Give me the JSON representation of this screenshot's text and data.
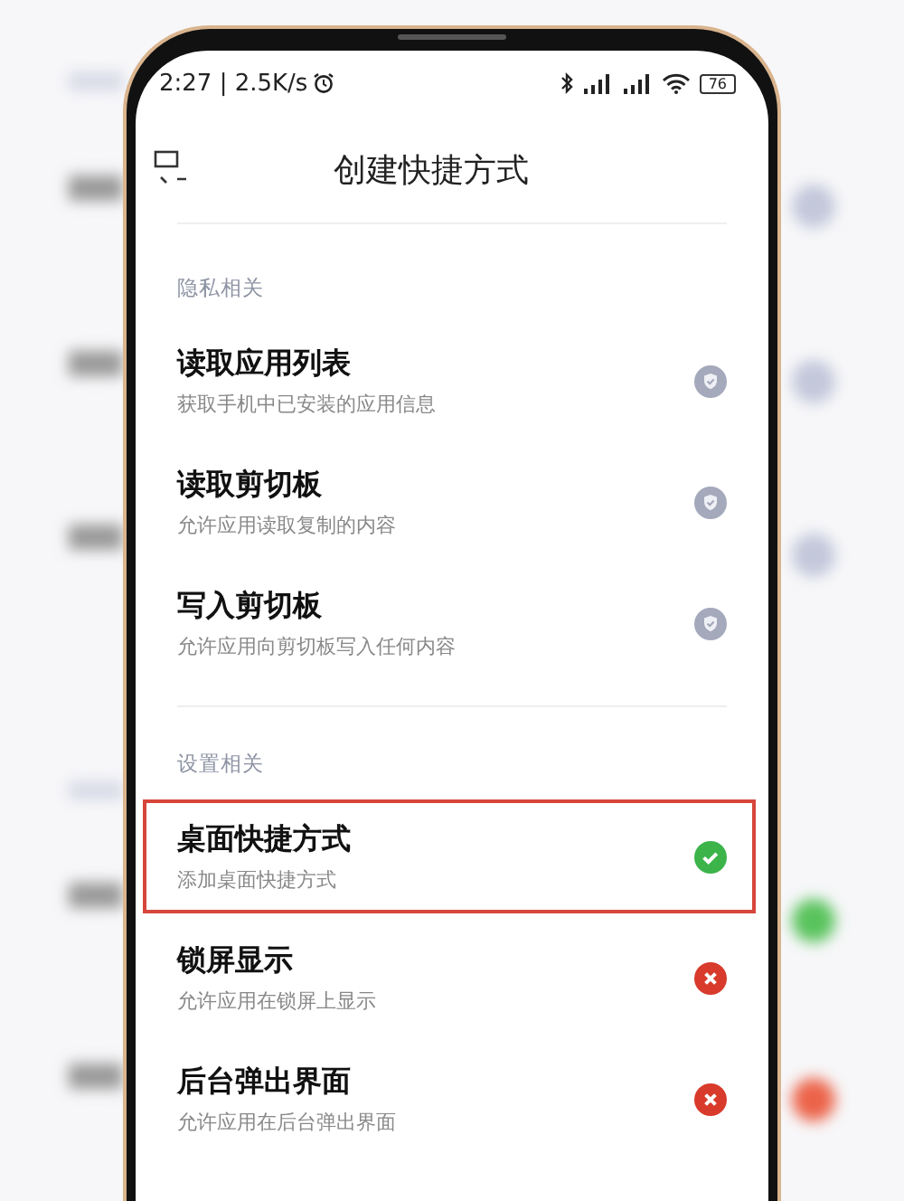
{
  "status_bar": {
    "time_speed": "2:27 | 2.5K/s",
    "battery": "76"
  },
  "header": {
    "title": "创建快捷方式"
  },
  "sections": [
    {
      "title": "隐私相关",
      "items": [
        {
          "title": "读取应用列表",
          "subtitle": "获取手机中已安装的应用信息",
          "kind": "fixed",
          "highlighted": false
        },
        {
          "title": "读取剪切板",
          "subtitle": "允许应用读取复制的内容",
          "kind": "fixed",
          "highlighted": false
        },
        {
          "title": "写入剪切板",
          "subtitle": "允许应用向剪切板写入任何内容",
          "kind": "fixed",
          "highlighted": false
        }
      ]
    },
    {
      "title": "设置相关",
      "items": [
        {
          "title": "桌面快捷方式",
          "subtitle": "添加桌面快捷方式",
          "kind": "granted",
          "highlighted": true
        },
        {
          "title": "锁屏显示",
          "subtitle": "允许应用在锁屏上显示",
          "kind": "denied",
          "highlighted": false
        },
        {
          "title": "后台弹出界面",
          "subtitle": "允许应用在后台弹出界面",
          "kind": "denied",
          "highlighted": false
        }
      ]
    }
  ]
}
